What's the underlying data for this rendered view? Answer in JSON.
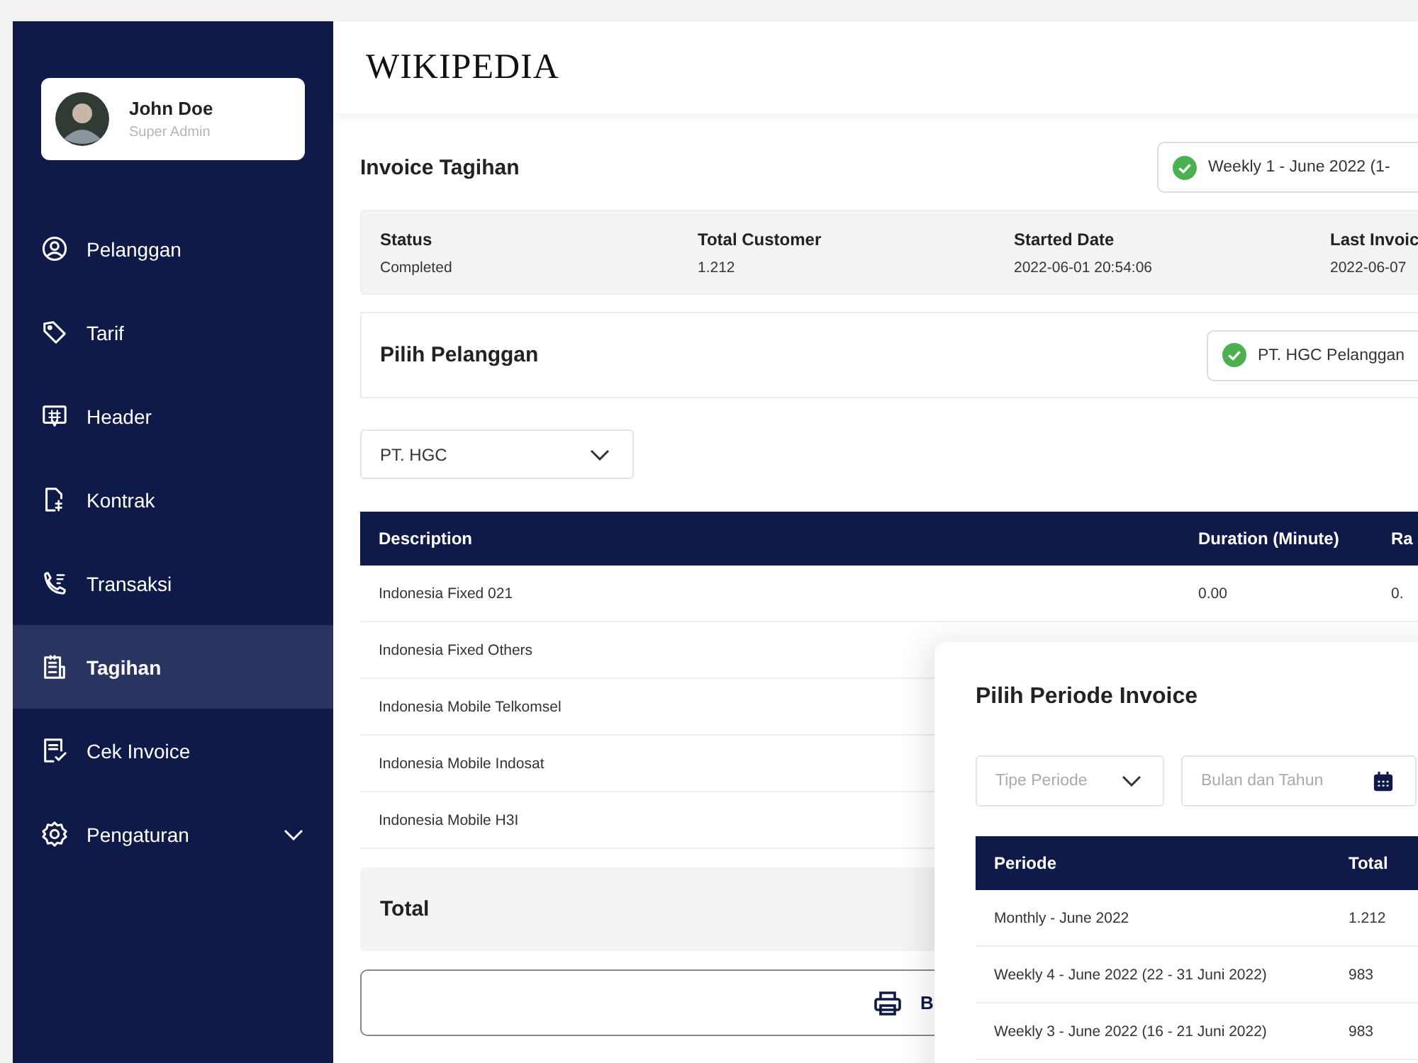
{
  "profile": {
    "name": "John Doe",
    "role": "Super Admin"
  },
  "nav": [
    {
      "label": "Pelanggan",
      "selected": false,
      "expandable": false
    },
    {
      "label": "Tarif",
      "selected": false,
      "expandable": false
    },
    {
      "label": "Header",
      "selected": false,
      "expandable": false
    },
    {
      "label": "Kontrak",
      "selected": false,
      "expandable": false
    },
    {
      "label": "Transaksi",
      "selected": false,
      "expandable": false
    },
    {
      "label": "Tagihan",
      "selected": true,
      "expandable": false
    },
    {
      "label": "Cek Invoice",
      "selected": false,
      "expandable": false
    },
    {
      "label": "Pengaturan",
      "selected": false,
      "expandable": true
    }
  ],
  "logo": "WIKIPEDIA",
  "page_title": "Invoice Tagihan",
  "period_badge": "Weekly 1 - June 2022 (1-",
  "summary": [
    {
      "label": "Status",
      "value": "Completed"
    },
    {
      "label": "Total Customer",
      "value": "1.212"
    },
    {
      "label": "Started Date",
      "value": "2022-06-01 20:54:06"
    },
    {
      "label": "Last Invoic",
      "value": "2022-06-07"
    }
  ],
  "customer_card": {
    "title": "Pilih Pelanggan",
    "badge": "PT. HGC Pelanggan"
  },
  "customer_select": {
    "value": "PT. HGC"
  },
  "table": {
    "columns": [
      "Description",
      "Duration (Minute)",
      "Ra"
    ],
    "rows": [
      [
        "Indonesia Fixed 021",
        "0.00",
        "0."
      ],
      [
        "Indonesia Fixed Others"
      ],
      [
        "Indonesia Mobile Telkomsel"
      ],
      [
        "Indonesia Mobile Indosat"
      ],
      [
        "Indonesia Mobile H3I"
      ]
    ]
  },
  "total_label": "Total",
  "print_button": "B",
  "modal": {
    "title": "Pilih Periode Invoice",
    "type_placeholder": "Tipe Periode",
    "date_placeholder": "Bulan dan Tahun",
    "columns": [
      "Periode",
      "Total"
    ],
    "rows": [
      [
        "Monthly - June 2022",
        "1.212"
      ],
      [
        "Weekly 4 - June 2022 (22 - 31 Juni 2022)",
        "983"
      ],
      [
        "Weekly 3 - June 2022 (16 - 21 Juni 2022)",
        "983"
      ]
    ]
  }
}
